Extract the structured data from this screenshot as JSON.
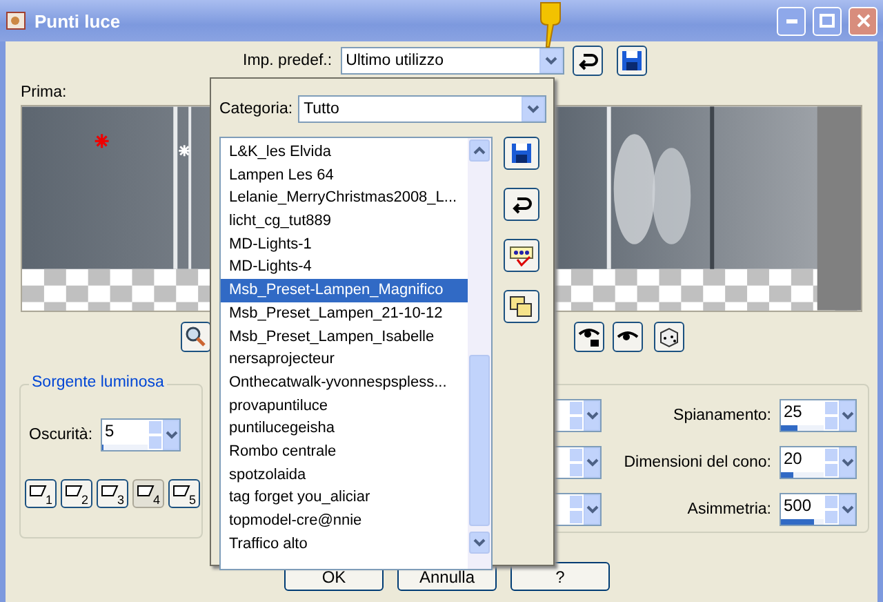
{
  "window": {
    "title": "Punti luce"
  },
  "preset": {
    "label": "Imp. predef.:",
    "value": "Ultimo utilizzo"
  },
  "preview": {
    "label": "Prima:"
  },
  "light_source": {
    "title": "Sorgente luminosa",
    "darkness": {
      "label": "Oscurità:",
      "value": "5",
      "level": 0.03
    },
    "lights": [
      {
        "label": "1",
        "selected": false
      },
      {
        "label": "2",
        "selected": false
      },
      {
        "label": "3",
        "selected": false
      },
      {
        "label": "4",
        "selected": true
      },
      {
        "label": "5",
        "selected": false
      }
    ]
  },
  "settings": [
    {
      "label": "Spianamento:",
      "value": "25",
      "level": 0.38
    },
    {
      "label": "Dimensioni del cono:",
      "value": "20",
      "level": 0.3
    },
    {
      "label": "Asimmetria:",
      "value": "500",
      "level": 0.78
    }
  ],
  "buttons": [
    "OK",
    "Annulla",
    "?"
  ],
  "preset_popup": {
    "category": {
      "label": "Categoria:",
      "value": "Tutto"
    },
    "presets": [
      {
        "name": "L&K_les Elvida",
        "selected": false
      },
      {
        "name": "Lampen Les 64",
        "selected": false
      },
      {
        "name": "Lelanie_MerryChristmas2008_L...",
        "selected": false
      },
      {
        "name": "licht_cg_tut889",
        "selected": false
      },
      {
        "name": "MD-Lights-1",
        "selected": false
      },
      {
        "name": "MD-Lights-4",
        "selected": false
      },
      {
        "name": "Msb_Preset-Lampen_Magnifico",
        "selected": true
      },
      {
        "name": "Msb_Preset_Lampen_21-10-12",
        "selected": false
      },
      {
        "name": "Msb_Preset_Lampen_Isabelle",
        "selected": false
      },
      {
        "name": "nersaprojecteur",
        "selected": false
      },
      {
        "name": "Onthecatwalk-yvonnespspless...",
        "selected": false
      },
      {
        "name": "provapuntiluce",
        "selected": false
      },
      {
        "name": "puntilucegeisha",
        "selected": false
      },
      {
        "name": "Rombo centrale",
        "selected": false
      },
      {
        "name": "spotzolaida",
        "selected": false
      },
      {
        "name": "tag forget you_aliciar",
        "selected": false
      },
      {
        "name": "topmodel-cre@nnie",
        "selected": false
      },
      {
        "name": "Traffico alto",
        "selected": false
      }
    ]
  }
}
